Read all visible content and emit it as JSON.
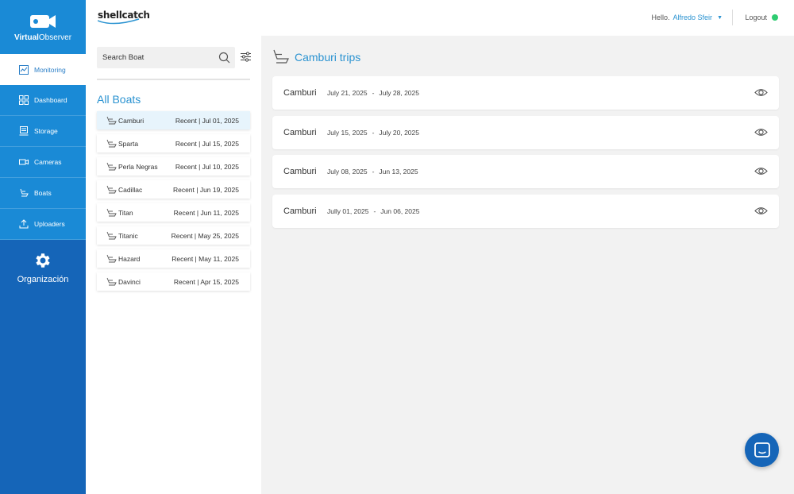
{
  "app": {
    "brand_bold": "Virtual",
    "brand_rest": "Observer",
    "logo_text": "shellcatch"
  },
  "sidebar": {
    "items": [
      {
        "label": "Monitoring",
        "icon": "chart-icon",
        "active": true
      },
      {
        "label": "Dashboard",
        "icon": "grid-icon"
      },
      {
        "label": "Storage",
        "icon": "server-icon"
      },
      {
        "label": "Cameras",
        "icon": "video-camera-icon"
      },
      {
        "label": "Boats",
        "icon": "boat-icon"
      },
      {
        "label": "Uploaders",
        "icon": "upload-icon"
      }
    ],
    "org_label": "Organización"
  },
  "header": {
    "hello": "Hello.",
    "user_name": "Alfredo Sfeir",
    "logout": "Logout",
    "status_color": "#2ecc71"
  },
  "search": {
    "placeholder": "Search Boat"
  },
  "boats": {
    "title": "All Boats",
    "items": [
      {
        "name": "Camburi",
        "recent": "Recent | Jul 01, 2025"
      },
      {
        "name": "Sparta",
        "recent": "Recent | Jul 15, 2025"
      },
      {
        "name": "Perla Negras",
        "recent": "Recent | Jul 10, 2025"
      },
      {
        "name": "Cadillac",
        "recent": "Recent | Jun 19, 2025"
      },
      {
        "name": "Titan",
        "recent": "Recent | Jun 11, 2025"
      },
      {
        "name": "Titanic",
        "recent": "Recent | May 25, 2025"
      },
      {
        "name": "Hazard",
        "recent": "Recent | May 11, 2025"
      },
      {
        "name": "Davinci",
        "recent": "Recent | Apr 15, 2025"
      }
    ]
  },
  "trips": {
    "title": "Camburi trips",
    "items": [
      {
        "name": "Camburi",
        "start": "July 21, 2025",
        "sep": "-",
        "end": "July 28, 2025"
      },
      {
        "name": "Camburi",
        "start": "July 15, 2025",
        "sep": "-",
        "end": "July 20, 2025"
      },
      {
        "name": "Camburi",
        "start": "July 08, 2025",
        "sep": "-",
        "end": "Jun 13, 2025"
      },
      {
        "name": "Camburi",
        "start": "Jully 01, 2025",
        "sep": "-",
        "end": "Jun 06, 2025"
      }
    ]
  },
  "colors": {
    "accent": "#2b93d1",
    "sidebar": "#1565b8",
    "sidebar_top": "#1a8ad6"
  }
}
